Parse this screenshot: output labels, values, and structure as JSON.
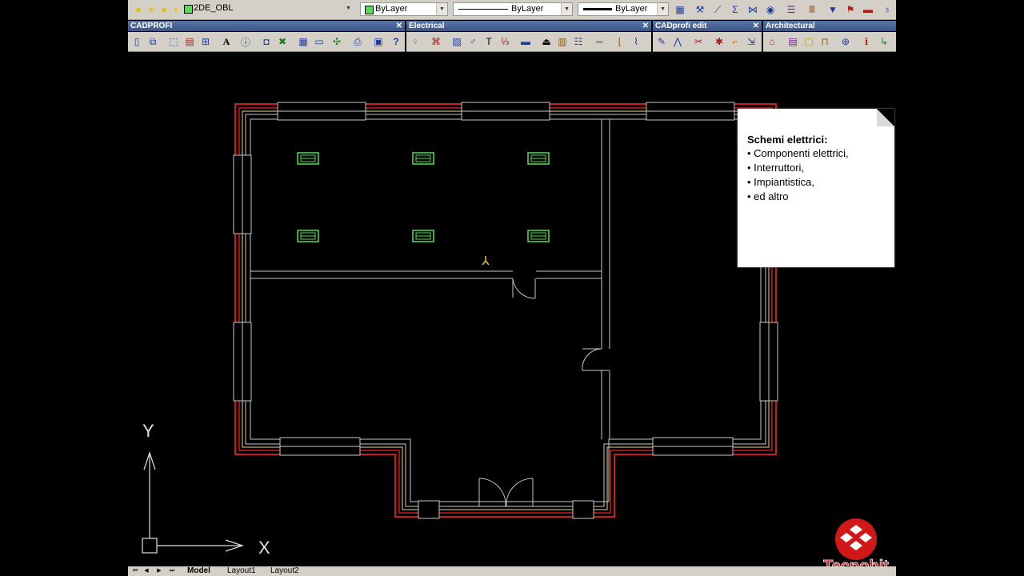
{
  "layer_control": {
    "layer_name": "2DE_OBL"
  },
  "properties": {
    "color": "ByLayer",
    "linetype": "ByLayer",
    "lineweight": "ByLayer"
  },
  "toolbars": {
    "cadprofi": {
      "title": "CADPROFI"
    },
    "electrical": {
      "title": "Electrical"
    },
    "cadprofi_edit": {
      "title": "CADprofi edit"
    },
    "architectural": {
      "title": "Architectural"
    },
    "close_glyph": "✕"
  },
  "callout": {
    "title": "Schemi elettrici:",
    "items": [
      "• Componenti elettrici,",
      "• Interruttori,",
      "• Impiantistica,",
      "• ed altro"
    ]
  },
  "ucs": {
    "x_label": "X",
    "y_label": "Y"
  },
  "layout_tabs": [
    "Model",
    "Layout1",
    "Layout2"
  ],
  "logo": {
    "text": "Tecnobit"
  },
  "colors": {
    "wall_outer": "#cc1a1a",
    "wall_insulation": "#e8d79a",
    "wall_inner": "#c8c8c8",
    "lamp": "#55dd55",
    "socket": "#e0c040",
    "toolbar_bg": "#d4d0c8",
    "logo_red": "#d01818"
  }
}
